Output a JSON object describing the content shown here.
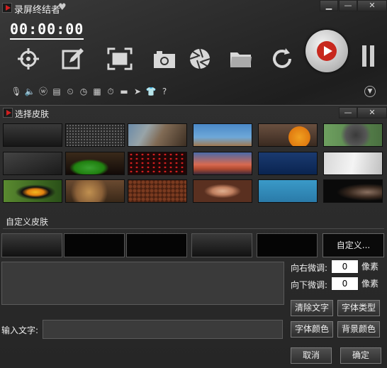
{
  "window": {
    "title": "录屏终结者",
    "min_label": "▁",
    "max_label": "—",
    "close_label": "✕"
  },
  "timer": "00:00:00",
  "toolbar": {
    "icons": [
      "crosshair-icon",
      "edit-icon",
      "fullscreen-icon",
      "camera-icon",
      "aperture-icon",
      "folder-icon",
      "refresh-icon"
    ]
  },
  "small_icons": [
    "mic-mute-icon",
    "speaker-icon",
    "wordpress-icon",
    "film-icon",
    "timer-icon",
    "clock-icon",
    "clapper-icon",
    "stopwatch-icon",
    "keyboard-icon",
    "cursor-icon",
    "shirt-icon",
    "help-icon"
  ],
  "skin_window": {
    "title": "选择皮肤",
    "min_label": "—",
    "close_label": "✕",
    "custom_section_label": "自定义皮肤",
    "custom_button": "自定义...",
    "right_adjust_label": "向右微调:",
    "down_adjust_label": "向下微调:",
    "right_value": "0",
    "down_value": "0",
    "unit_label": "像素",
    "clear_text_btn": "清除文字",
    "font_type_btn": "字体类型",
    "font_color_btn": "字体颜色",
    "bg_color_btn": "背景颜色",
    "input_label": "输入文字:",
    "input_value": "",
    "cancel_btn": "取消",
    "ok_btn": "确定"
  },
  "colors": {
    "record_red": "#c8281e",
    "dark_bg": "#1e1e1e"
  }
}
